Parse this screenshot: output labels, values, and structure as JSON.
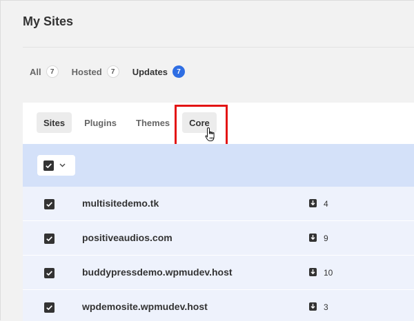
{
  "page": {
    "title": "My Sites"
  },
  "filters": [
    {
      "label": "All",
      "count": "7"
    },
    {
      "label": "Hosted",
      "count": "7"
    },
    {
      "label": "Updates",
      "count": "7"
    }
  ],
  "sub_tabs": [
    "Sites",
    "Plugins",
    "Themes",
    "Core"
  ],
  "sites": [
    {
      "name": "multisitedemo.tk",
      "updates": "4"
    },
    {
      "name": "positiveaudios.com",
      "updates": "9"
    },
    {
      "name": "buddypressdemo.wpmudev.host",
      "updates": "10"
    },
    {
      "name": "wpdemosite.wpmudev.host",
      "updates": "3"
    }
  ],
  "colors": {
    "accent": "#2f6ee3",
    "highlight": "#e31414",
    "select_bar": "#d4e1f9",
    "row_bg": "#eef2fc"
  }
}
